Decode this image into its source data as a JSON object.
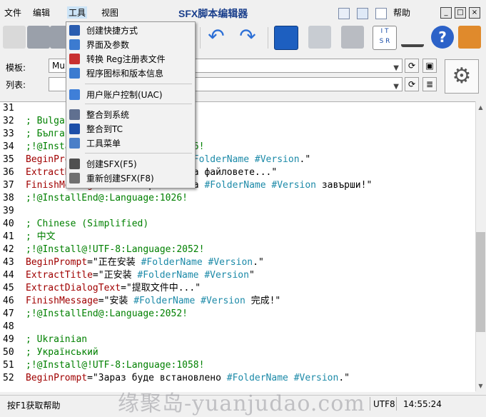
{
  "menubar": {
    "file": "文件",
    "edit": "编辑",
    "tools": "工具",
    "view": "视图",
    "help": "帮助"
  },
  "app": {
    "title": "SFX脚本编辑器"
  },
  "toolbar": {
    "icons": [
      "pencil-icon",
      "save-icon",
      "save-as-icon",
      "undo-icon",
      "redo-icon",
      "shortcut-icon",
      "folder-icon",
      "binder-icon",
      "its-grid-icon",
      "sort-icon",
      "help-icon",
      "exit-icon"
    ]
  },
  "template": {
    "label": "模板:",
    "value": "Mul"
  },
  "list": {
    "label": "列表:",
    "value": ""
  },
  "tools_menu": {
    "items": [
      {
        "label": "创建快捷方式",
        "icon": "shortcut-icon",
        "color": "#2a5db0"
      },
      {
        "label": "界面及参数",
        "icon": "window-icon",
        "color": "#3c7bd0"
      },
      {
        "label": "转换 Reg注册表文件",
        "icon": "registry-icon",
        "color": "#c83030"
      },
      {
        "label": "程序图标和版本信息",
        "icon": "app-icon",
        "color": "#3c7bd0"
      },
      {
        "label": "用户账户控制(UAC)",
        "icon": "uac-shield-icon",
        "color": "#3f7fd8"
      },
      {
        "label": "整合到系统",
        "icon": "integrate-icon",
        "color": "#607090"
      },
      {
        "label": "整合到TC",
        "icon": "floppy-icon",
        "color": "#1d4fa8"
      },
      {
        "label": "工具菜单",
        "icon": "menu-icon",
        "color": "#4a7fc8"
      },
      {
        "label": "创建SFX(F5)",
        "icon": "create-sfx-icon",
        "color": "#505050"
      },
      {
        "label": "重新创建SFX(F8)",
        "icon": "recreate-sfx-icon",
        "color": "#707070"
      }
    ]
  },
  "editor": {
    "lines": [
      {
        "n": "31",
        "t": ""
      },
      {
        "n": "32",
        "t": "; Bulgarian"
      },
      {
        "n": "33",
        "t": "; Български"
      },
      {
        "n": "34",
        "t": ";!@Install@!UTF-8:Language:1026!"
      },
      {
        "n": "35",
        "t": "BeginPrompt=\"Ще се инсталира #FolderName #Version.\""
      },
      {
        "n": "36",
        "t": "ExtractDialogText=\"Извличане на файловете...\""
      },
      {
        "n": "37",
        "t": "FinishMessage=\"Инсталирането на #FolderName #Version завърши!\""
      },
      {
        "n": "38",
        "t": ";!@InstallEnd@:Language:1026!"
      },
      {
        "n": "39",
        "t": ""
      },
      {
        "n": "40",
        "t": "; Chinese (Simplified)"
      },
      {
        "n": "41",
        "t": "; 中文"
      },
      {
        "n": "42",
        "t": ";!@Install@!UTF-8:Language:2052!"
      },
      {
        "n": "43",
        "t": "BeginPrompt=\"正在安装 #FolderName #Version.\""
      },
      {
        "n": "44",
        "t": "ExtractTitle=\"正安装 #FolderName #Version\""
      },
      {
        "n": "45",
        "t": "ExtractDialogText=\"提取文件中...\""
      },
      {
        "n": "46",
        "t": "FinishMessage=\"安装 #FolderName #Version 完成!\""
      },
      {
        "n": "47",
        "t": ";!@InstallEnd@:Language:2052!"
      },
      {
        "n": "48",
        "t": ""
      },
      {
        "n": "49",
        "t": "; Ukrainian"
      },
      {
        "n": "50",
        "t": "; Український"
      },
      {
        "n": "51",
        "t": ";!@Install@!UTF-8:Language:1058!"
      },
      {
        "n": "52",
        "t": "BeginPrompt=\"Зараз буде встановлено #FolderName #Version.\""
      }
    ]
  },
  "statusbar": {
    "hint": "按F1获取帮助",
    "encoding": "UTF8",
    "time": "14:55:24"
  },
  "watermark": "缘聚岛-yuanjudao.com"
}
